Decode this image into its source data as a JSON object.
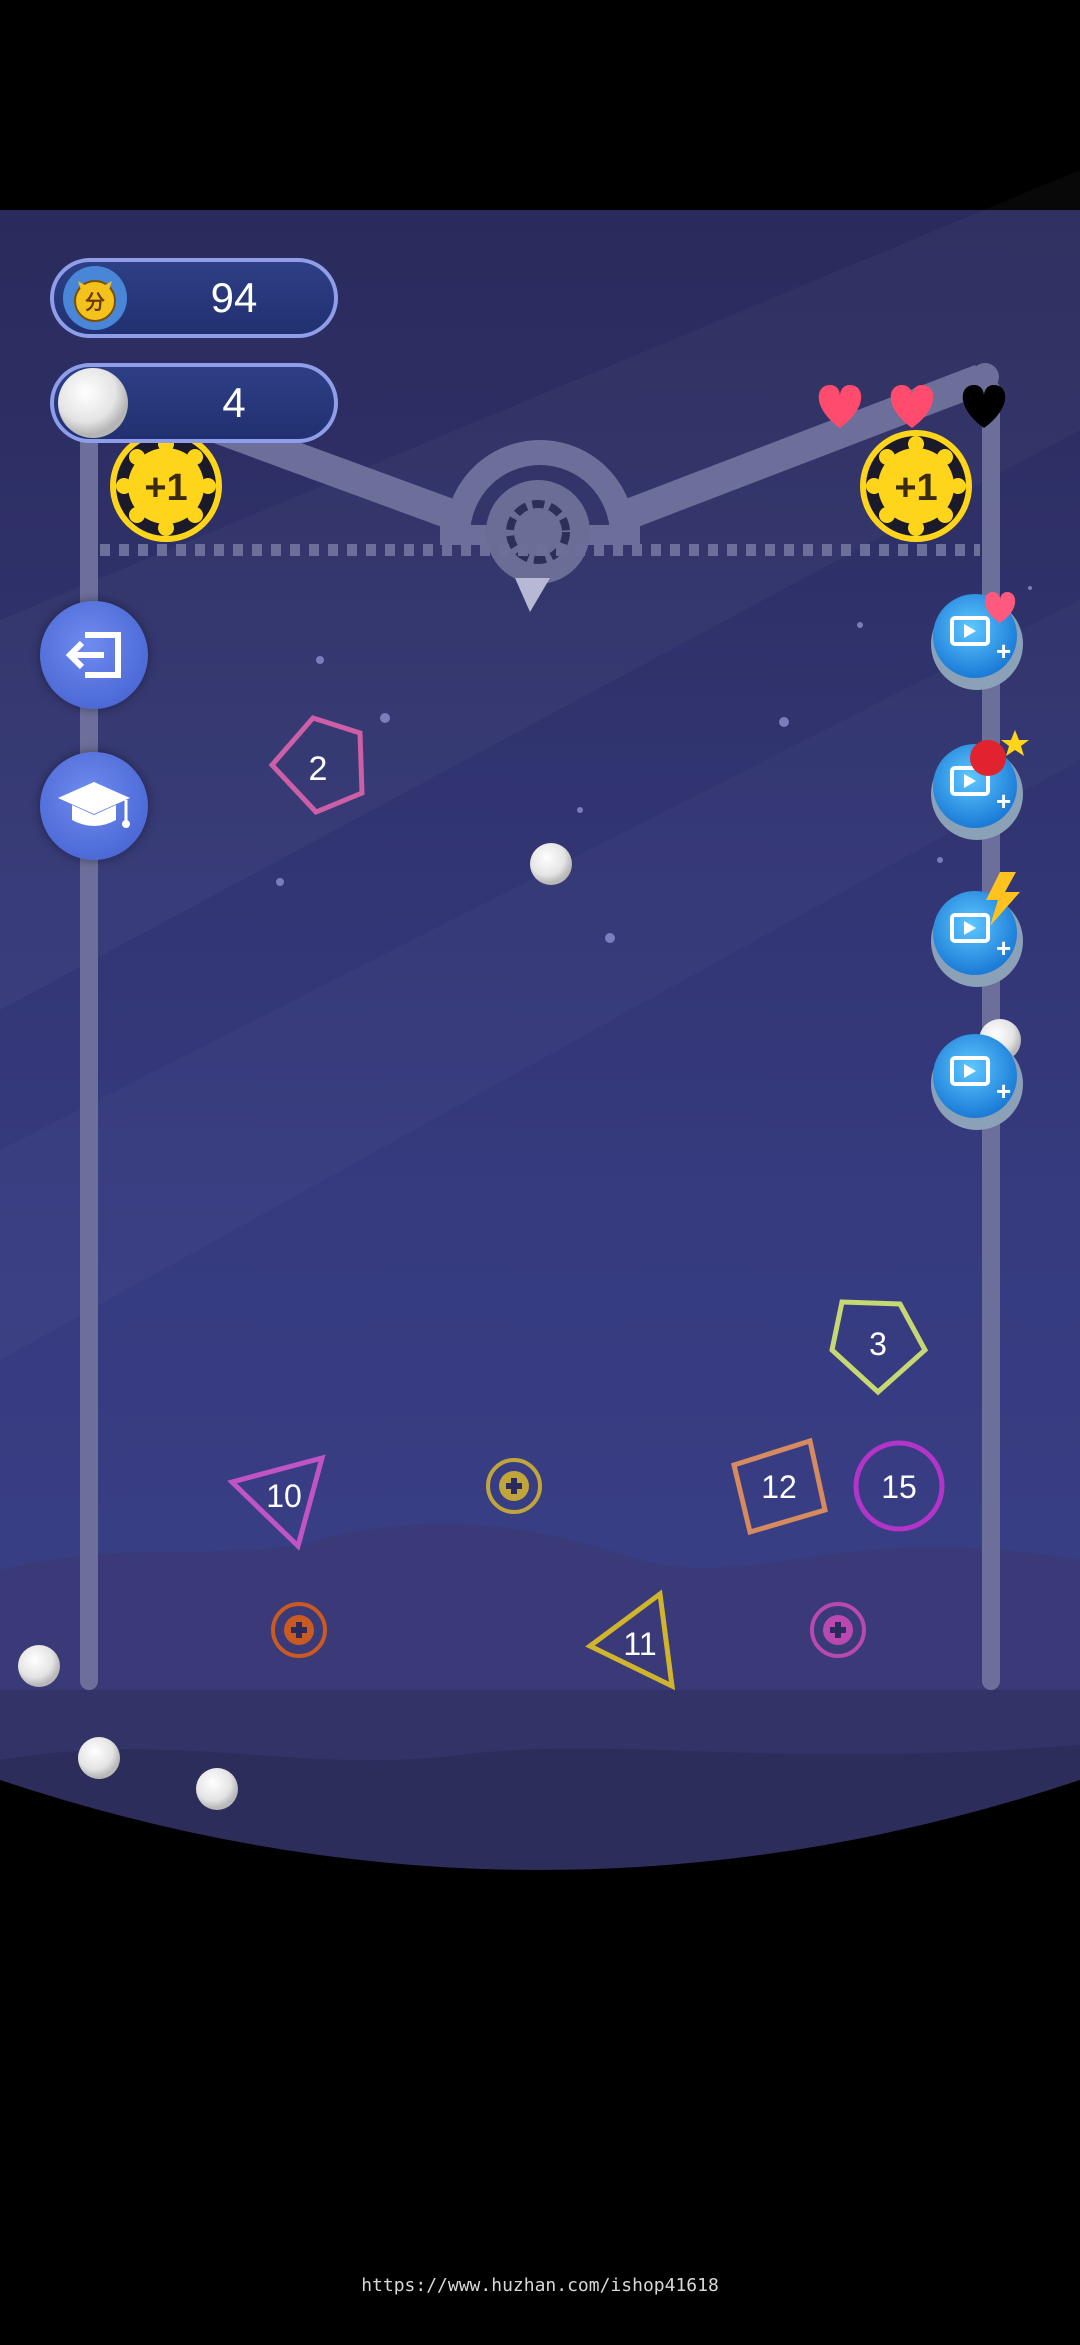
{
  "hud": {
    "score": "94",
    "score_icon": "coin-fen-icon",
    "balls": "4",
    "lives": {
      "filled": 2,
      "total": 3
    },
    "bonus_label": "+1"
  },
  "side_buttons": [
    {
      "name": "exit-icon"
    },
    {
      "name": "tutorial-icon"
    }
  ],
  "powerups": [
    {
      "name": "extra-life-video-button",
      "badge": "heart-icon"
    },
    {
      "name": "bomb-video-button",
      "badge": "bomb-icon"
    },
    {
      "name": "lightning-video-button",
      "badge": "lightning-icon"
    },
    {
      "name": "extra-ball-video-button",
      "badge": "ball-icon"
    }
  ],
  "shapes": [
    {
      "shape": "pentagon",
      "label": "2",
      "color": "#cc5fa5"
    },
    {
      "shape": "pentagon",
      "label": "3",
      "color": "#c5d872"
    },
    {
      "shape": "triangle",
      "label": "10",
      "color": "#c054c4"
    },
    {
      "shape": "square",
      "label": "12",
      "color": "#d58a60"
    },
    {
      "shape": "circle",
      "label": "15",
      "color": "#b234c8"
    },
    {
      "shape": "triangle",
      "label": "11",
      "color": "#d0b52c"
    }
  ],
  "pickups": [
    {
      "name": "plus-ball-pickup",
      "color": "#c0a63a"
    },
    {
      "name": "plus-ball-pickup",
      "color": "#c85a22"
    },
    {
      "name": "plus-ball-pickup",
      "color": "#b948b0"
    }
  ],
  "watermark": "https://www.huzhan.com/ishop41618",
  "colors": {
    "bg_top": "#2a2b5c",
    "bg_bottom": "#3a3f85",
    "rail": "#6c6f99",
    "hud_border": "#8f9ee8",
    "gold": "#ffd51c"
  }
}
